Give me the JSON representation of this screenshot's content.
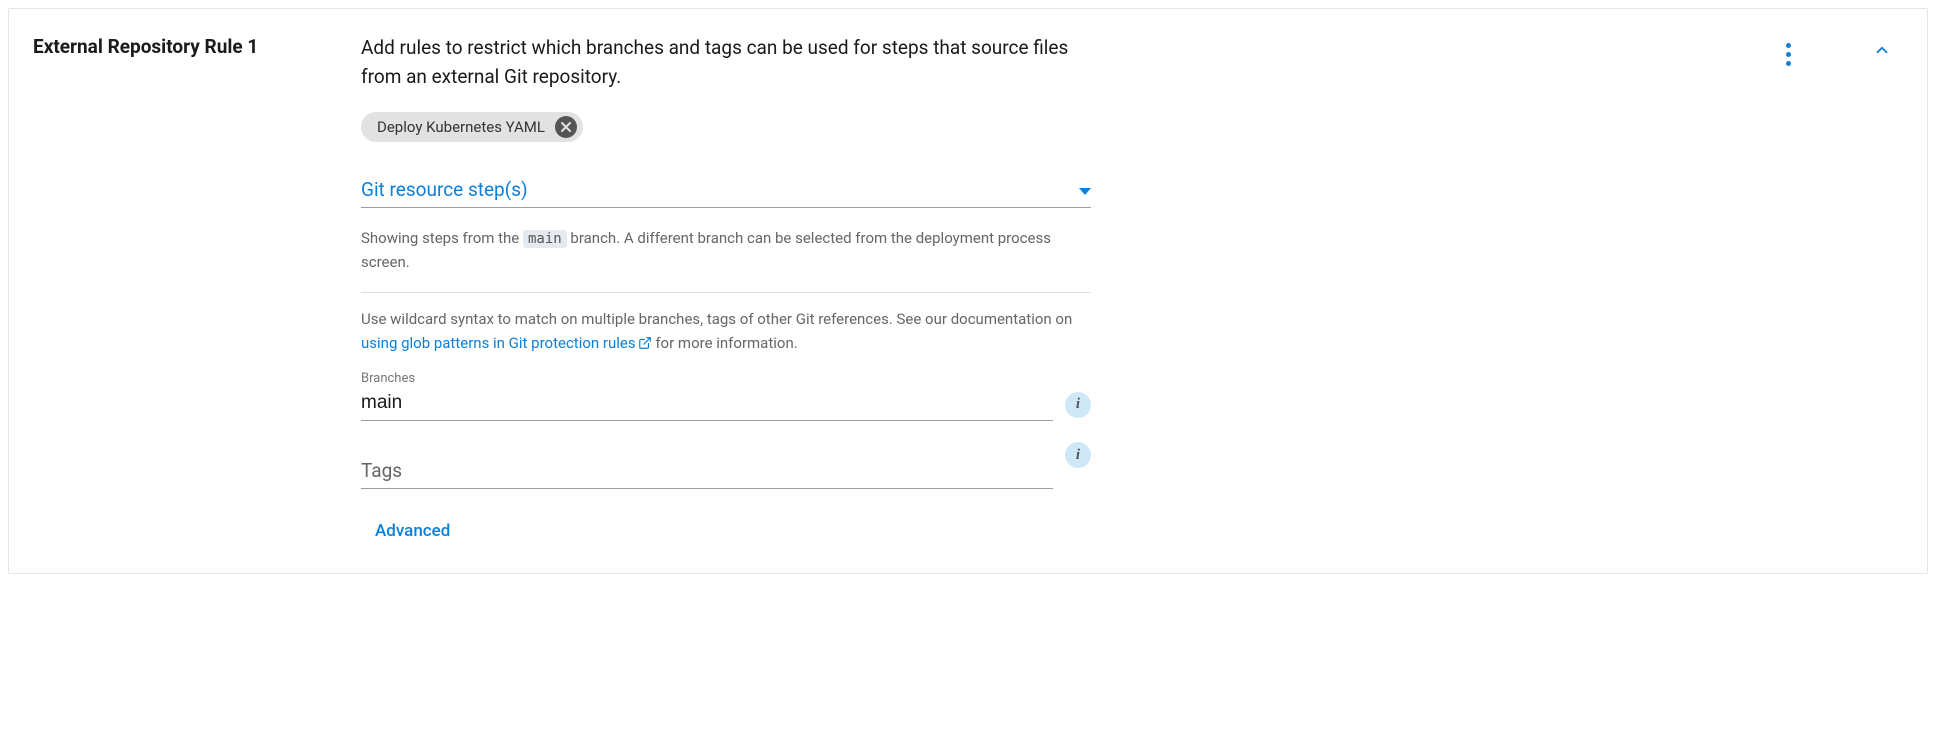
{
  "rule": {
    "title": "External Repository Rule 1",
    "description": "Add rules to restrict which branches and tags can be used for steps that source files from an external Git repository."
  },
  "chip": {
    "label": "Deploy Kubernetes YAML"
  },
  "git_resource": {
    "label": "Git resource step(s)",
    "helper_prefix": "Showing steps from the ",
    "helper_branch": "main",
    "helper_suffix": " branch. A different branch can be selected from the deployment process screen."
  },
  "wildcard": {
    "prefix": "Use wildcard syntax to match on multiple branches, tags of other Git references. See our documentation on ",
    "link_text": "using glob patterns in Git protection rules",
    "suffix": " for more information."
  },
  "branches": {
    "label": "Branches",
    "value": "main"
  },
  "tags": {
    "label": "Tags",
    "value": ""
  },
  "advanced_label": "Advanced",
  "info_glyph": "i"
}
